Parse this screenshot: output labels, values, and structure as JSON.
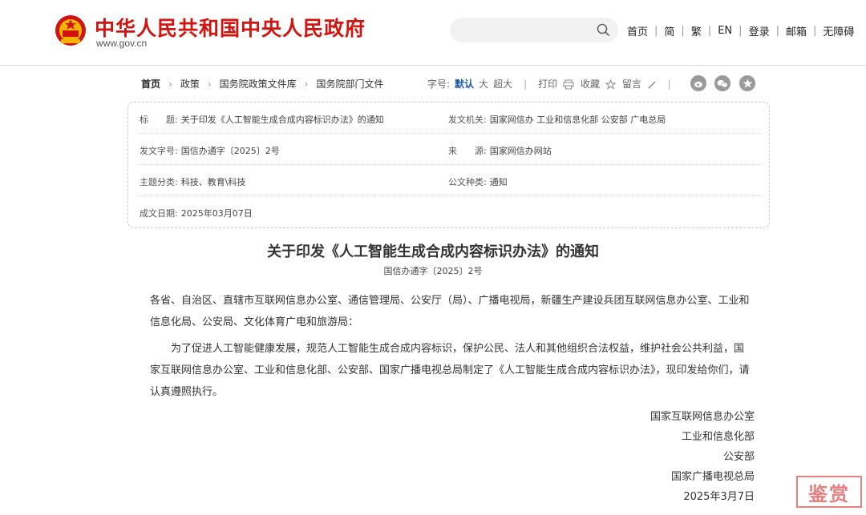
{
  "header": {
    "site_title": "中华人民共和国中央人民政府",
    "site_url": "www.gov.cn",
    "search_placeholder": "",
    "nav": [
      "首页",
      "简",
      "繁",
      "EN",
      "登录",
      "邮箱",
      "无障碍"
    ]
  },
  "breadcrumb": {
    "items": [
      "首页",
      "政策",
      "国务院政策文件库",
      "国务院部门文件"
    ]
  },
  "tools": {
    "font_label": "字号:",
    "font_default": "默认",
    "font_large": "大",
    "font_xlarge": "超大",
    "print": "打印",
    "favorite": "收藏",
    "comment": "留言"
  },
  "share_icons": [
    "weibo-icon",
    "wechat-icon",
    "favorite-star-icon"
  ],
  "info": {
    "title_label": "标　　题:",
    "title_value": "关于印发《人工智能生成合成内容标识办法》的通知",
    "issuer_label": "发文机关:",
    "issuer_value": "国家网信办 工业和信息化部 公安部 广电总局",
    "docno_label": "发文字号:",
    "docno_value": "国信办通字〔2025〕2号",
    "source_label": "来　　源:",
    "source_value": "国家网信办网站",
    "topic_label": "主题分类:",
    "topic_value": "科技、教育\\科技",
    "type_label": "公文种类:",
    "type_value": "通知",
    "date_label": "成文日期:",
    "date_value": "2025年03月07日"
  },
  "article": {
    "title": "关于印发《人工智能生成合成内容标识办法》的通知",
    "doc_no": "国信办通字〔2025〕2号",
    "para1": "各省、自治区、直辖市互联网信息办公室、通信管理局、公安厅（局）、广播电视局，新疆生产建设兵团互联网信息办公室、工业和信息化局、公安局、文化体育广电和旅游局：",
    "para2": "　　为了促进人工智能健康发展，规范人工智能生成合成内容标识，保护公民、法人和其他组织合法权益，维护社会公共利益，国家互联网信息办公室、工业和信息化部、公安部、国家广播电视总局制定了《人工智能生成合成内容标识办法》，现印发给你们，请认真遵照执行。",
    "signers": [
      "国家互联网信息办公室",
      "工业和信息化部",
      "公安部",
      "国家广播电视总局",
      "2025年3月7日"
    ]
  },
  "watermark": "鉴赏",
  "colors": {
    "brand_red": "#d1140f",
    "link_blue": "#1e5aa8"
  }
}
